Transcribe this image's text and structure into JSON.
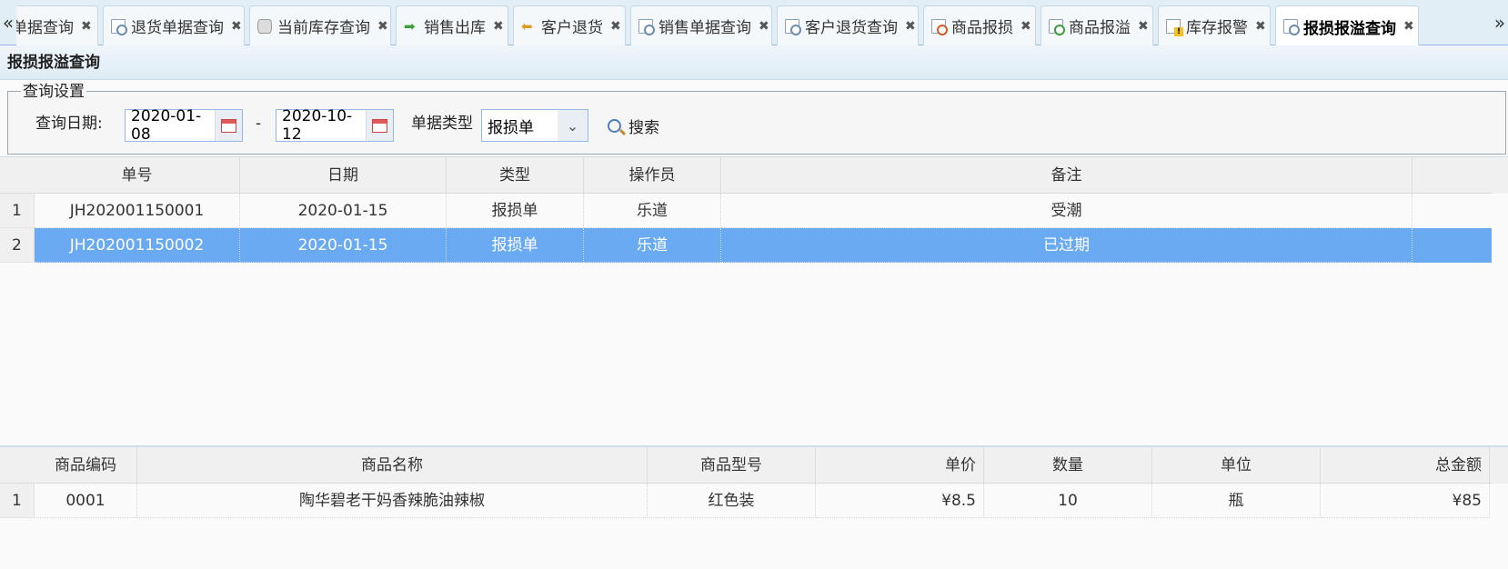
{
  "tabbar": {
    "scroll_left": "«",
    "scroll_right": "»",
    "close_glyph": "✖",
    "tabs": [
      {
        "label": "单据查询",
        "icon": "doc-search-icon",
        "active": false
      },
      {
        "label": "退货单据查询",
        "icon": "doc-search-icon",
        "active": false
      },
      {
        "label": "当前库存查询",
        "icon": "database-icon",
        "active": false
      },
      {
        "label": "销售出库",
        "icon": "arrow-right-icon",
        "active": false
      },
      {
        "label": "客户退货",
        "icon": "arrow-left-icon",
        "active": false
      },
      {
        "label": "销售单据查询",
        "icon": "doc-search-icon",
        "active": false
      },
      {
        "label": "客户退货查询",
        "icon": "doc-search-icon",
        "active": false
      },
      {
        "label": "商品报损",
        "icon": "doc-minus-icon",
        "active": false
      },
      {
        "label": "商品报溢",
        "icon": "doc-plus-icon",
        "active": false
      },
      {
        "label": "库存报警",
        "icon": "warning-icon",
        "active": false
      },
      {
        "label": "报损报溢查询",
        "icon": "doc-search-icon",
        "active": true
      }
    ]
  },
  "panel": {
    "title": "报损报溢查询"
  },
  "query": {
    "legend": "查询设置",
    "date_label": "查询日期:",
    "start_date": "2020-01-08",
    "separator": "-",
    "end_date": "2020-10-12",
    "type_label": "单据类型",
    "type_value": "报损单",
    "search_label": "搜索"
  },
  "orders": {
    "columns": [
      "单号",
      "日期",
      "类型",
      "操作员",
      "备注"
    ],
    "rows": [
      {
        "num": "1",
        "id": "JH202001150001",
        "date": "2020-01-15",
        "type": "报损单",
        "operator": "乐道",
        "remark": "受潮",
        "selected": false
      },
      {
        "num": "2",
        "id": "JH202001150002",
        "date": "2020-01-15",
        "type": "报损单",
        "operator": "乐道",
        "remark": "已过期",
        "selected": true
      }
    ]
  },
  "items": {
    "columns": [
      "商品编码",
      "商品名称",
      "商品型号",
      "单价",
      "数量",
      "单位",
      "总金额"
    ],
    "rows": [
      {
        "num": "1",
        "code": "0001",
        "name": "陶华碧老干妈香辣脆油辣椒",
        "model": "红色装",
        "price": "¥8.5",
        "qty": "10",
        "unit": "瓶",
        "total": "¥85"
      }
    ]
  },
  "colors": {
    "selected_row": "#6aaaf3",
    "tab_border": "#95b8e7"
  }
}
